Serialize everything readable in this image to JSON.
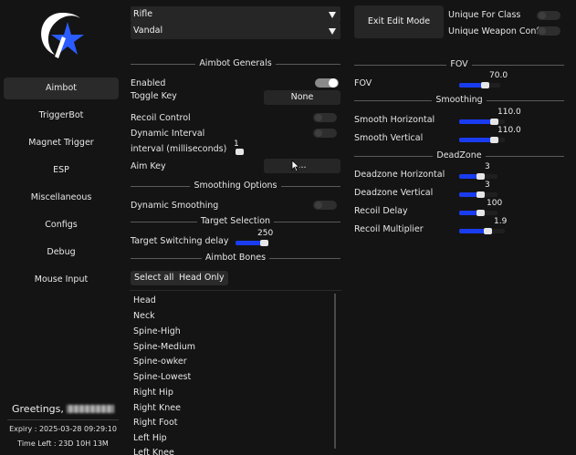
{
  "sidebar": {
    "items": [
      {
        "label": "Aimbot",
        "active": true
      },
      {
        "label": "TriggerBot"
      },
      {
        "label": "Magnet Trigger"
      },
      {
        "label": "ESP"
      },
      {
        "label": "Miscellaneous"
      },
      {
        "label": "Configs"
      },
      {
        "label": "Debug"
      },
      {
        "label": "Mouse Input"
      }
    ],
    "greeting": "Greetings,",
    "expiry": "Expiry : 2025-03-28 09:29:10",
    "time_left": "Time Left : 23D 10H 13M"
  },
  "top": {
    "weapon_class": "Rifle",
    "weapon": "Vandal",
    "exit_edit_mode": "Exit Edit Mode",
    "unique_for_class": "Unique For Class",
    "unique_weapon_config": "Unique Weapon Config"
  },
  "aimbot_generals": {
    "title": "Aimbot Generals",
    "enabled_label": "Enabled",
    "enabled": true,
    "toggle_key_label": "Toggle Key",
    "toggle_key_value": "None",
    "recoil_control_label": "Recoil Control",
    "recoil_control": false,
    "dynamic_interval_label": "Dynamic Interval",
    "dynamic_interval": false,
    "interval_label": "interval (milliseconds)",
    "interval_value": "1",
    "interval_fraction": 0.01,
    "aim_key_label": "Aim Key",
    "aim_key_value": "..."
  },
  "smoothing_options": {
    "title": "Smoothing Options",
    "dynamic_smoothing_label": "Dynamic Smoothing",
    "dynamic_smoothing": false
  },
  "target_selection": {
    "title": "Target Selection",
    "switching_delay_label": "Target Switching delay",
    "switching_delay_value": "250",
    "switching_delay_fraction": 0.85
  },
  "aimbot_bones": {
    "title": "Aimbot Bones",
    "select_all": "Select all",
    "head_only": "Head Only",
    "bones": [
      "Head",
      "Neck",
      "Spine-High",
      "Spine-Medium",
      "Spine-owker",
      "Spine-Lowest",
      "Right Hip",
      "Right Knee",
      "Right Foot",
      "Left Hip",
      "Left Knee"
    ]
  },
  "fov": {
    "title": "FOV",
    "label": "FOV",
    "value": "70.0",
    "fraction": 0.62
  },
  "smoothing": {
    "title": "Smoothing",
    "horizontal_label": "Smooth Horizontal",
    "horizontal_value": "110.0",
    "horizontal_fraction": 0.75,
    "vertical_label": "Smooth Vertical",
    "vertical_value": "110.0",
    "vertical_fraction": 0.75
  },
  "deadzone": {
    "title": "DeadZone",
    "horizontal_label": "Deadzone Horizontal",
    "horizontal_value": "3",
    "horizontal_fraction": 0.55,
    "vertical_label": "Deadzone Vertical",
    "vertical_value": "3",
    "vertical_fraction": 0.55,
    "recoil_delay_label": "Recoil Delay",
    "recoil_delay_value": "100",
    "recoil_delay_fraction": 0.55,
    "recoil_multiplier_label": "Recoil Multiplier",
    "recoil_multiplier_value": "1.9",
    "recoil_multiplier_fraction": 0.62
  },
  "colors": {
    "accent": "#1a3cf0",
    "background": "#141414"
  }
}
